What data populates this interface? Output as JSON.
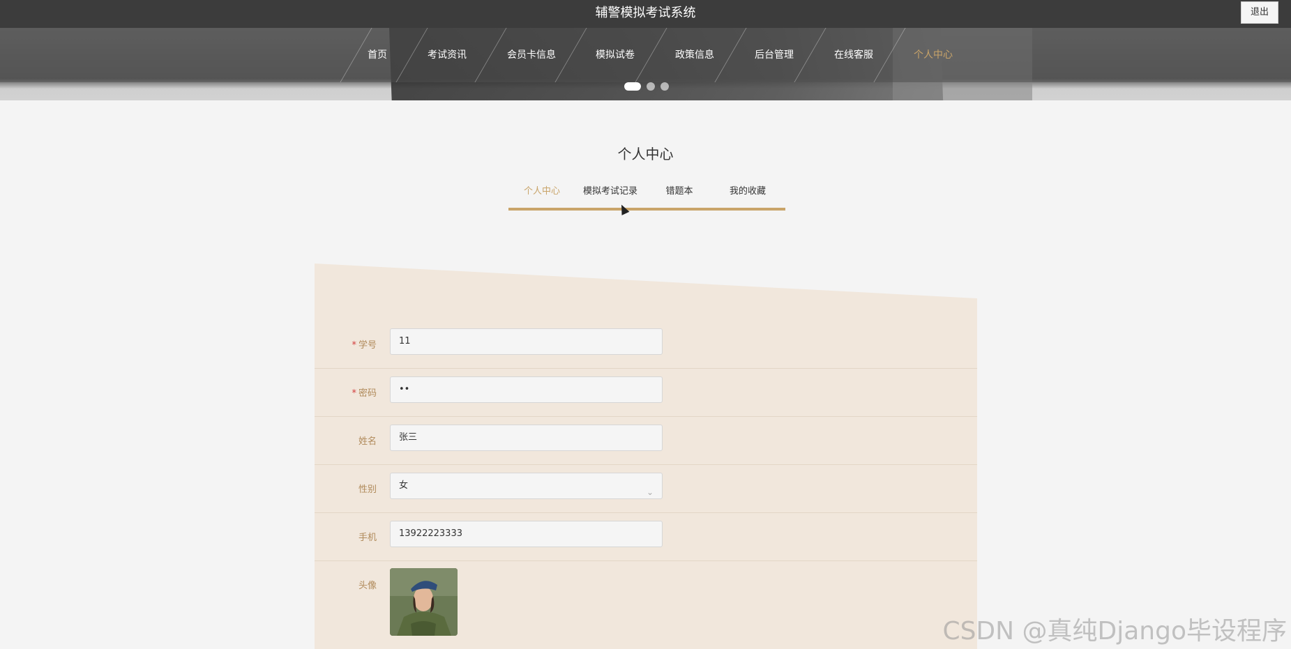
{
  "header": {
    "title": "辅警模拟考试系统",
    "logout_label": "退出"
  },
  "nav": {
    "items": [
      "首页",
      "考试资讯",
      "会员卡信息",
      "模拟试卷",
      "政策信息",
      "后台管理",
      "在线客服",
      "个人中心"
    ],
    "active_index": 7
  },
  "carousel": {
    "slide_count": 3,
    "active_index": 0
  },
  "section": {
    "title": "个人中心",
    "tabs": [
      "个人中心",
      "模拟考试记录",
      "错题本",
      "我的收藏"
    ],
    "active_tab": 0
  },
  "form": {
    "student_id": {
      "label": "学号",
      "required": "*",
      "value": "11"
    },
    "password": {
      "label": "密码",
      "required": "*",
      "value": "••"
    },
    "name": {
      "label": "姓名",
      "value": "张三"
    },
    "gender": {
      "label": "性别",
      "value": "女"
    },
    "phone": {
      "label": "手机",
      "value": "13922223333"
    },
    "avatar": {
      "label": "头像"
    }
  },
  "watermark": "CSDN @真纯Django毕设程序",
  "colors": {
    "accent": "#c9a469",
    "topbar": "#3c3c3c",
    "panel": "#f1e7dc"
  }
}
